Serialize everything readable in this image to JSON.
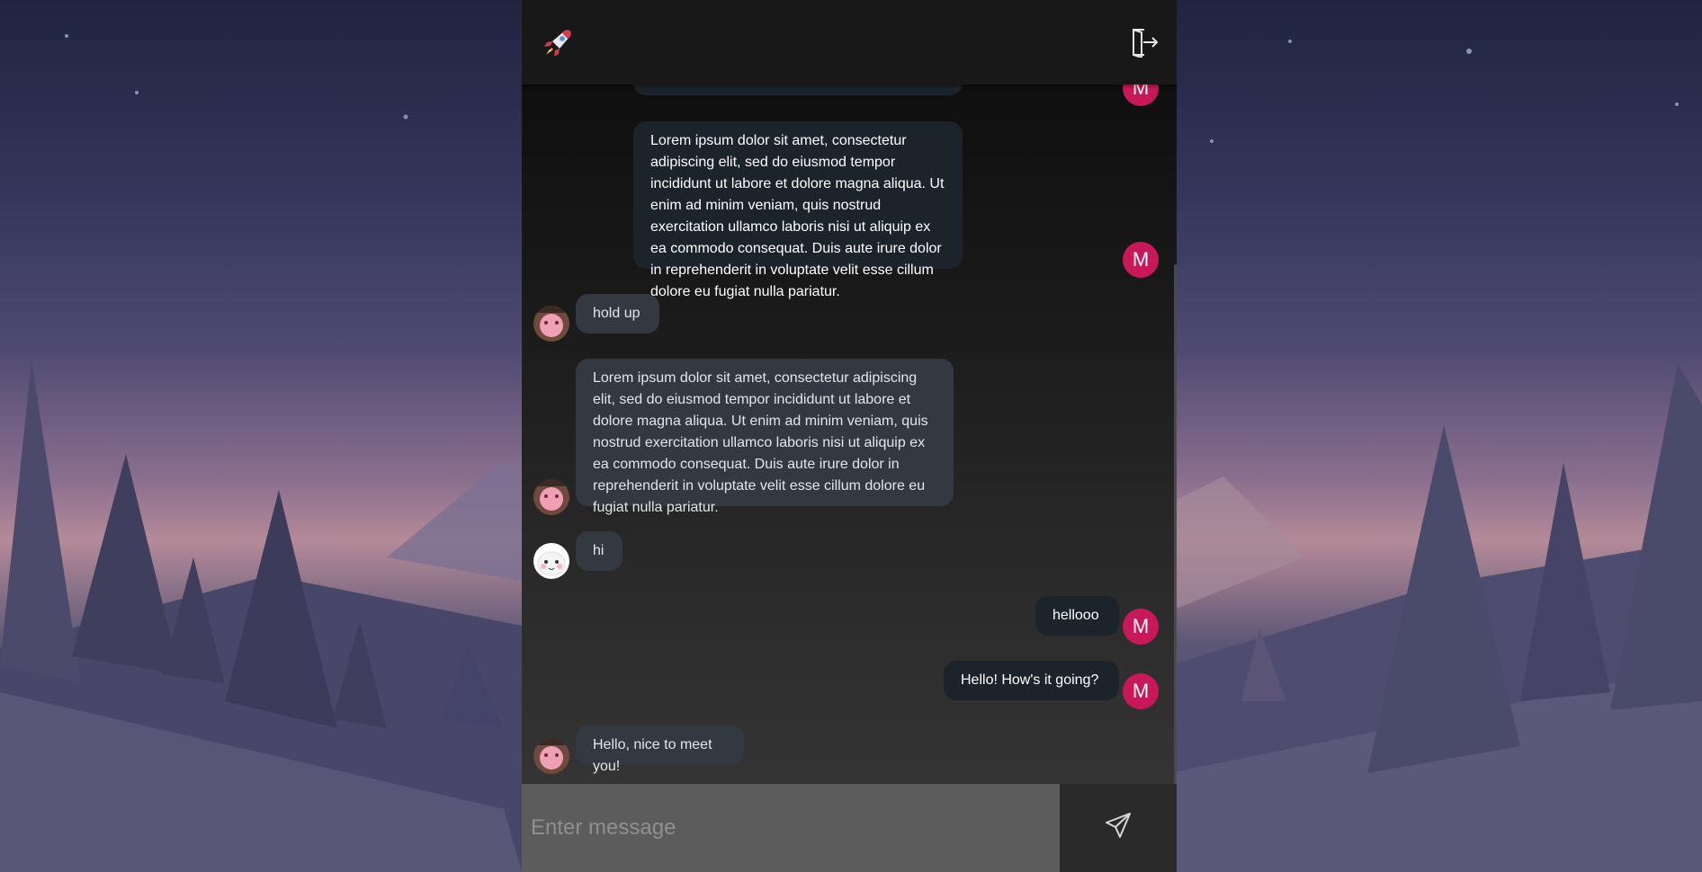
{
  "app": {
    "logo_icon": "rocket-icon",
    "logout_icon": "logout-door-icon",
    "accent": "#c8185a"
  },
  "messages": [
    {
      "side": "out",
      "text": "Lorem ipsum dolor sit amet, consectetur adipiscing elit, sed do eiusmod tempor incididunt ut labore et dolore magna aliqua. Ut enim ad minim veniam, quis nostrud exercitation ullamco laboris nisi ut aliquip ex ea commodo consequat. Duis aute irure dolor in reprehenderit in voluptate velit esse cillum dolore eu fugiat nulla pariatur.",
      "avatar": "M"
    },
    {
      "side": "in",
      "text": "hold up",
      "avatar": "pink-character"
    },
    {
      "side": "in",
      "text": "Lorem ipsum dolor sit amet, consectetur adipiscing elit, sed do eiusmod tempor incididunt ut labore et dolore magna aliqua. Ut enim ad minim veniam, quis nostrud exercitation ullamco laboris nisi ut aliquip ex ea commodo consequat. Duis aute irure dolor in reprehenderit in voluptate velit esse cillum dolore eu fugiat nulla pariatur.",
      "avatar": "pink-character"
    },
    {
      "side": "in",
      "text": "hi",
      "avatar": "white-cartoon"
    },
    {
      "side": "out",
      "text": "hellooo",
      "avatar": "M"
    },
    {
      "side": "out",
      "text": "Hello! How's it going?",
      "avatar": "M"
    },
    {
      "side": "in",
      "text": "Hello, nice to meet you!",
      "avatar": "pink-character"
    }
  ],
  "partial_top": {
    "avatar": "M"
  },
  "composer": {
    "placeholder": "Enter message",
    "send_icon": "send-paper-plane-icon"
  }
}
